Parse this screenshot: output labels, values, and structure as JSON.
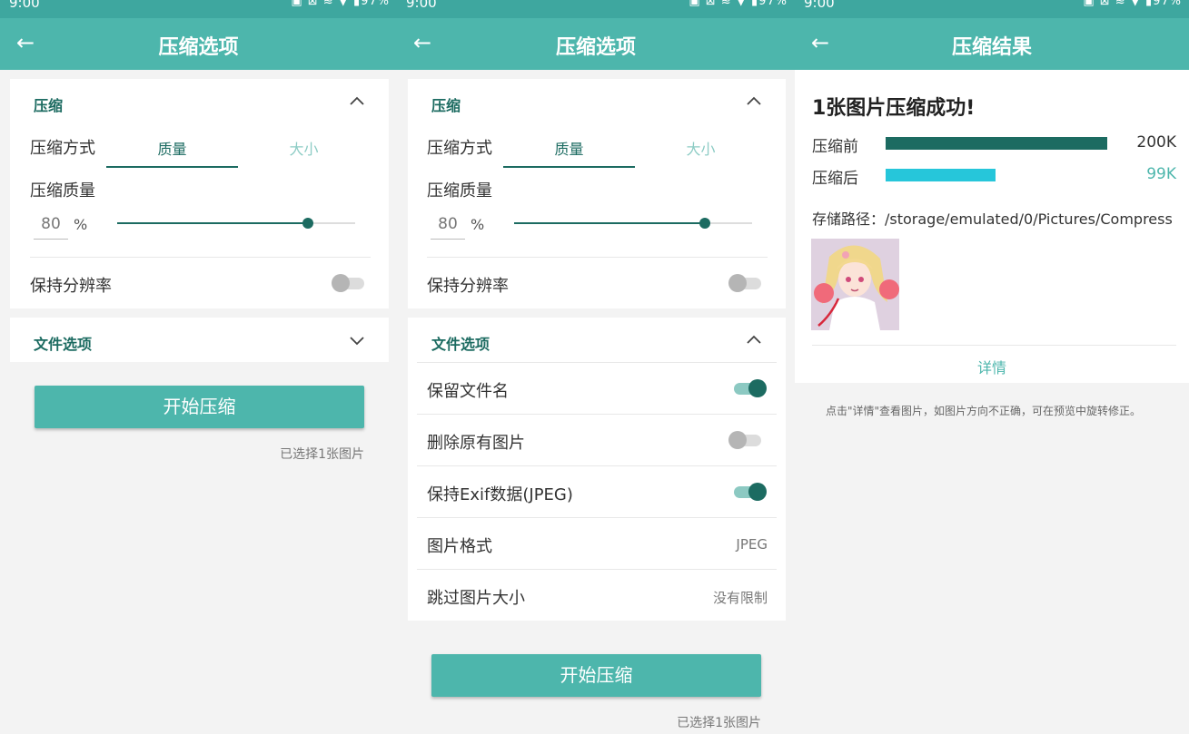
{
  "status_bar": {
    "time": "9:00",
    "icons": "▣ ⊠ ≋ ▼ ▮97%"
  },
  "left_screen": {
    "title": "压缩选项",
    "compress_section": {
      "title": "压缩",
      "method_label": "压缩方式",
      "tab_quality": "质量",
      "tab_size": "大小",
      "quality_label": "压缩质量",
      "quality_value": "80",
      "percent_sign": "%",
      "slider_fraction": 0.8,
      "keep_resolution_label": "保持分辨率",
      "keep_resolution_on": false
    },
    "file_section": {
      "title": "文件选项"
    },
    "start_button": "开始压缩",
    "selected_note": "已选择1张图片"
  },
  "middle_screen": {
    "title": "压缩选项",
    "compress_section": {
      "title": "压缩",
      "method_label": "压缩方式",
      "tab_quality": "质量",
      "tab_size": "大小",
      "quality_label": "压缩质量",
      "quality_value": "80",
      "percent_sign": "%",
      "slider_fraction": 0.8,
      "keep_resolution_label": "保持分辨率",
      "keep_resolution_on": false
    },
    "file_section": {
      "title": "文件选项",
      "keep_filename_label": "保留文件名",
      "keep_filename_on": true,
      "delete_original_label": "删除原有图片",
      "delete_original_on": false,
      "keep_exif_label": "保持Exif数据(JPEG)",
      "keep_exif_on": true,
      "format_label": "图片格式",
      "format_value": "JPEG",
      "skip_size_label": "跳过图片大小",
      "skip_size_value": "没有限制"
    },
    "start_button": "开始压缩",
    "selected_note": "已选择1张图片"
  },
  "right_screen": {
    "title": "压缩结果",
    "result_title": "1张图片压缩成功!",
    "before_label": "压缩前",
    "before_value": "200K",
    "after_label": "压缩后",
    "after_value": "99K",
    "after_fraction": 0.495,
    "path_text": "存储路径：/storage/emulated/0/Pictures/Compress",
    "details_link": "详情",
    "hint": "点击\"详情\"查看图片，如图片方向不正确，可在预览中旋转修正。"
  },
  "colors": {
    "appbar": "#4db6ac",
    "status": "#3ea79f",
    "accent_dark": "#1c6b61",
    "before_bar": "#1c6b61",
    "after_bar": "#26c6da",
    "after_value": "#4db6ac"
  },
  "icons": {
    "back": "arrow-left-icon",
    "expand": "chevron-down-icon",
    "collapse": "chevron-up-icon"
  }
}
